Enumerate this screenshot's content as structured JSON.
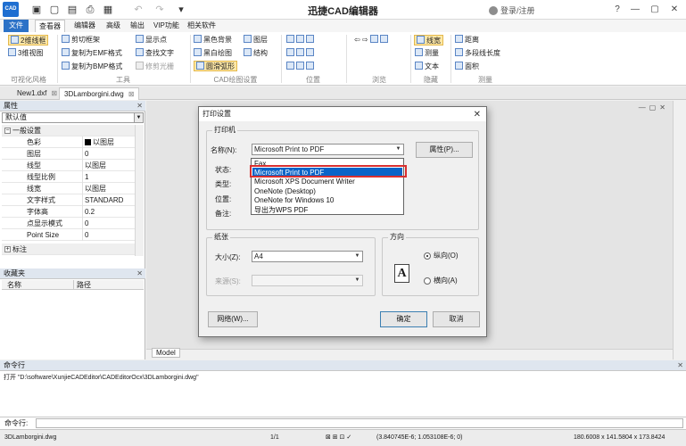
{
  "app": {
    "logo_text": "CAD",
    "title": "迅捷CAD编辑器",
    "login": "登录/注册"
  },
  "menu_tabs": [
    "文件",
    "查看器",
    "编辑器",
    "高级",
    "输出",
    "VIP功能",
    "相关软件"
  ],
  "ribbon": {
    "items": [
      "2维线框",
      "3维视图",
      "剪切框架",
      "复制为EMF格式",
      "复制为BMP格式",
      "显示点",
      "查找文字",
      "修剪光栅",
      "黑色背景",
      "黑白绘图",
      "圆滑弧形",
      "图层",
      "结构",
      "线宽",
      "测量",
      "文本",
      "距离",
      "多段线长度",
      "面积"
    ],
    "groups": [
      "可视化风格",
      "工具",
      "CAD绘图设置",
      "位置",
      "浏览",
      "隐藏",
      "测量"
    ]
  },
  "doc_tabs": [
    "New1.dxf",
    "3DLamborgini.dwg"
  ],
  "properties_panel": {
    "title": "属性",
    "selector": "默认值",
    "rows": [
      {
        "key": "一般设置",
        "value": ""
      },
      {
        "key": "色彩",
        "value": "以图层"
      },
      {
        "key": "图层",
        "value": "0"
      },
      {
        "key": "线型",
        "value": "以图层"
      },
      {
        "key": "线型比例",
        "value": "1"
      },
      {
        "key": "线宽",
        "value": "以图层"
      },
      {
        "key": "文字样式",
        "value": "STANDARD"
      },
      {
        "key": "字体高",
        "value": "0.2"
      },
      {
        "key": "点显示模式",
        "value": "0"
      },
      {
        "key": "Point Size",
        "value": "0"
      },
      {
        "key": "标注",
        "value": ""
      }
    ]
  },
  "favorites_panel": {
    "title": "收藏夹",
    "columns": [
      "名称",
      "路径"
    ]
  },
  "model_tab": "Model",
  "command": {
    "title": "命令行",
    "output": "打开 \"D:\\software\\XunjieCADEditor\\CADEditorOcx\\3DLamborgini.dwg\"",
    "input_label": "命令行:"
  },
  "statusbar": {
    "file": "3DLamborgini.dwg",
    "page": "1/1",
    "coords": "(3.840745E-6; 1.053108E-6; 0)",
    "size": "180.6008 x 141.5804 x 173.8424"
  },
  "print_dialog": {
    "title": "打印设置",
    "printer_section": "打印机",
    "name_label": "名称(N):",
    "name_value": "Microsoft Print to PDF",
    "properties_button": "属性(P)...",
    "status_label": "状态:",
    "type_label": "类型:",
    "location_label": "位置:",
    "comment_label": "备注:",
    "printer_options": [
      "Fax",
      "Microsoft Print to PDF",
      "Microsoft XPS Document Writer",
      "OneNote (Desktop)",
      "OneNote for Windows 10",
      "导出为WPS PDF"
    ],
    "selected_option_index": 1,
    "paper_section": "纸张",
    "size_label": "大小(Z):",
    "size_value": "A4",
    "source_label": "来源(S):",
    "source_value": "",
    "orientation_section": "方向",
    "orientation_icon_letter": "A",
    "portrait_label": "纵向(O)",
    "landscape_label": "横向(A)",
    "network_button": "网络(W)...",
    "ok_button": "确定",
    "cancel_button": "取消"
  },
  "colors": {
    "accent": "#2c72c7",
    "selection": "#0a64c8",
    "highlight_box": "#d93030"
  }
}
